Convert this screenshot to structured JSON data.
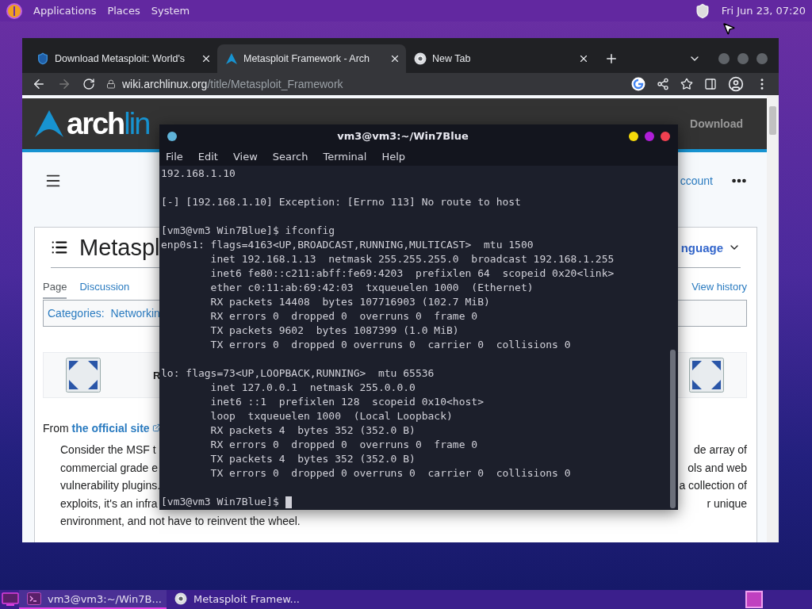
{
  "top_panel": {
    "menus": [
      "Applications",
      "Places",
      "System"
    ],
    "clock": "Fri Jun 23, 07:20"
  },
  "browser": {
    "tabs": [
      {
        "title": "Download Metasploit: World's",
        "selected": false
      },
      {
        "title": "Metasploit Framework - Arch",
        "selected": true
      },
      {
        "title": "New Tab",
        "selected": false
      }
    ],
    "forward_disabled": true,
    "url": {
      "host": "wiki.archlinux.org",
      "path": "/title/Metasploit_Framework"
    },
    "site_header": {
      "logo_bold": "arch",
      "logo_light": "lin",
      "nav_right": "Download"
    },
    "account_link": "ccount",
    "page": {
      "title": "Metaspl",
      "language": "nguage",
      "tabs": [
        {
          "label": "Page",
          "selected": true
        },
        {
          "label": "Discussion",
          "selected": false
        }
      ],
      "view_history": "View history",
      "categories_label": "Categories:",
      "category": "Networkin",
      "infobox_text": "R",
      "from_text": "From ",
      "from_link": "the official site",
      "quote_lines": [
        {
          "left": "Consider the MSF t",
          "right": "de array of"
        },
        {
          "left": "commercial grade e",
          "right": "ols and web"
        },
        {
          "left": "vulnerability plugins.",
          "right": "a collection of"
        },
        {
          "left": "exploits, it's an infra",
          "right": "r unique"
        },
        {
          "left": "environment, and not have to reinvent the wheel."
        }
      ]
    }
  },
  "terminal": {
    "title": "vm3@vm3:~/Win7Blue",
    "menus": [
      "File",
      "Edit",
      "View",
      "Search",
      "Terminal",
      "Help"
    ],
    "blocks": [
      [
        "192.168.1.10"
      ],
      [
        "[-] [192.168.1.10] Exception: [Errno 113] No route to host"
      ],
      [
        "[vm3@vm3 Win7Blue]$ ifconfig",
        "enp0s1: flags=4163<UP,BROADCAST,RUNNING,MULTICAST>  mtu 1500",
        "        inet 192.168.1.13  netmask 255.255.255.0  broadcast 192.168.1.255",
        "        inet6 fe80::c211:abff:fe69:4203  prefixlen 64  scopeid 0x20<link>",
        "        ether c0:11:ab:69:42:03  txqueuelen 1000  (Ethernet)",
        "        RX packets 14408  bytes 107716903 (102.7 MiB)",
        "        RX errors 0  dropped 0  overruns 0  frame 0",
        "        TX packets 9602  bytes 1087399 (1.0 MiB)",
        "        TX errors 0  dropped 0 overruns 0  carrier 0  collisions 0"
      ],
      [
        "lo: flags=73<UP,LOOPBACK,RUNNING>  mtu 65536",
        "        inet 127.0.0.1  netmask 255.0.0.0",
        "        inet6 ::1  prefixlen 128  scopeid 0x10<host>",
        "        loop  txqueuelen 1000  (Local Loopback)",
        "        RX packets 4  bytes 352 (352.0 B)",
        "        RX errors 0  dropped 0  overruns 0  frame 0",
        "        TX packets 4  bytes 352 (352.0 B)",
        "        TX errors 0  dropped 0 overruns 0  carrier 0  collisions 0"
      ]
    ],
    "prompt": "[vm3@vm3 Win7Blue]$"
  },
  "taskbar": {
    "items": [
      {
        "label": "vm3@vm3:~/Win7B...",
        "selected": true
      },
      {
        "label": "Metasploit Framew...",
        "selected": false
      }
    ]
  }
}
